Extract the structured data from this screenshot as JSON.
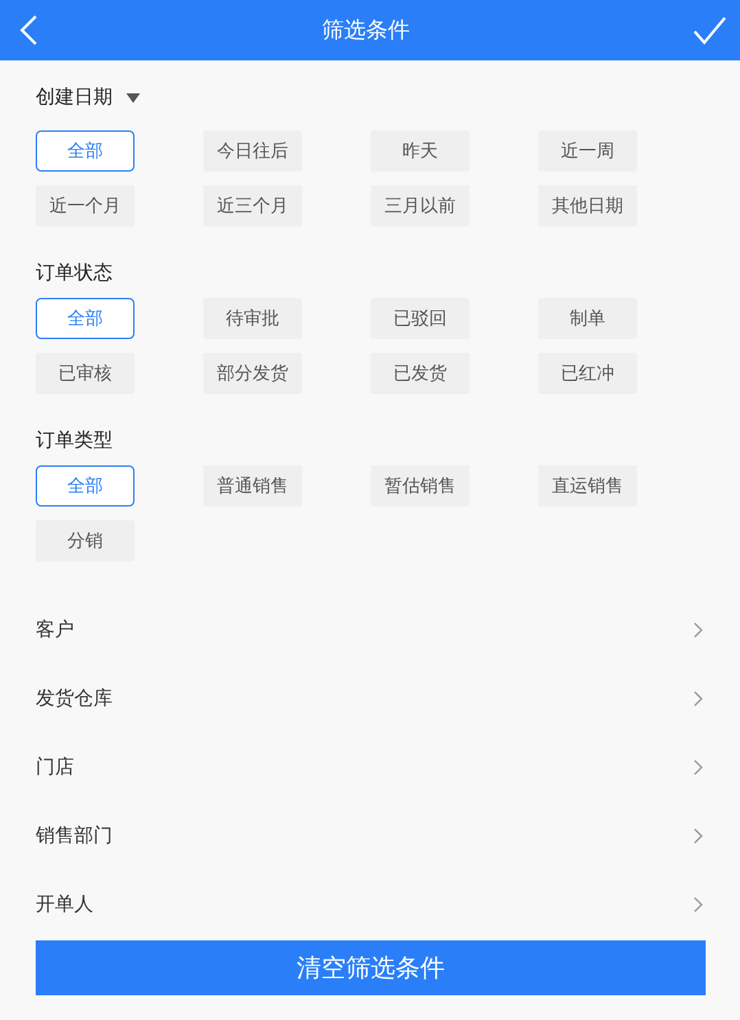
{
  "header": {
    "title": "筛选条件"
  },
  "sections": [
    {
      "title": "创建日期",
      "has_dropdown": true,
      "options": [
        {
          "label": "全部",
          "selected": true
        },
        {
          "label": "今日往后",
          "selected": false
        },
        {
          "label": "昨天",
          "selected": false
        },
        {
          "label": "近一周",
          "selected": false
        },
        {
          "label": "近一个月",
          "selected": false
        },
        {
          "label": "近三个月",
          "selected": false
        },
        {
          "label": "三月以前",
          "selected": false
        },
        {
          "label": "其他日期",
          "selected": false
        }
      ]
    },
    {
      "title": "订单状态",
      "has_dropdown": false,
      "options": [
        {
          "label": "全部",
          "selected": true
        },
        {
          "label": "待审批",
          "selected": false
        },
        {
          "label": "已驳回",
          "selected": false
        },
        {
          "label": "制单",
          "selected": false
        },
        {
          "label": "已审核",
          "selected": false
        },
        {
          "label": "部分发货",
          "selected": false
        },
        {
          "label": "已发货",
          "selected": false
        },
        {
          "label": "已红冲",
          "selected": false
        }
      ]
    },
    {
      "title": "订单类型",
      "has_dropdown": false,
      "options": [
        {
          "label": "全部",
          "selected": true
        },
        {
          "label": "普通销售",
          "selected": false
        },
        {
          "label": "暂估销售",
          "selected": false
        },
        {
          "label": "直运销售",
          "selected": false
        },
        {
          "label": "分销",
          "selected": false
        }
      ]
    }
  ],
  "rows": [
    {
      "label": "客户"
    },
    {
      "label": "发货仓库"
    },
    {
      "label": "门店"
    },
    {
      "label": "销售部门"
    },
    {
      "label": "开单人"
    }
  ],
  "clear_button": {
    "label": "清空筛选条件"
  }
}
